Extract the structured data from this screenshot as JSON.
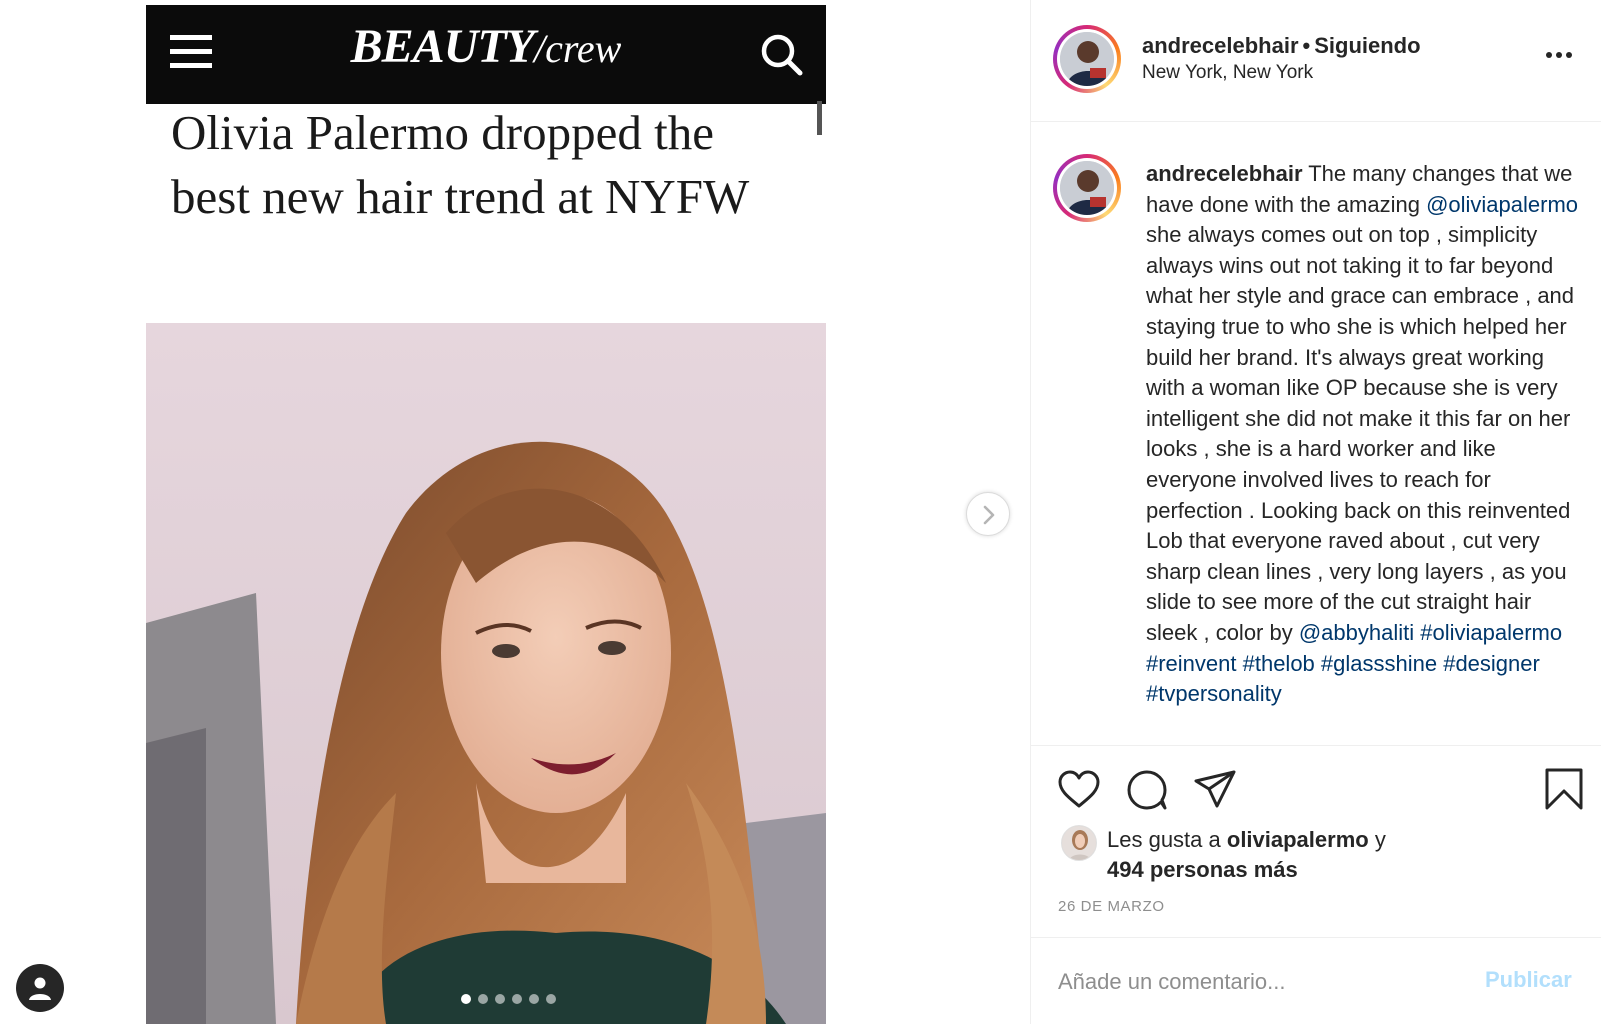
{
  "article": {
    "brand_main": "BEAUTY",
    "brand_slash": "/",
    "brand_sub": "crew",
    "headline": "Olivia Palermo dropped the best new hair trend at NYFW"
  },
  "carousel": {
    "total": 6,
    "active_index": 0
  },
  "header": {
    "username": "andrecelebhair",
    "separator": "•",
    "follow_status": "Siguiendo",
    "location": "New York, New York"
  },
  "caption": {
    "username": "andrecelebhair",
    "text_1": " The many changes that we have done with the amazing ",
    "mention_1": "@oliviapalermo",
    "text_2": " she always comes out on top , simplicity always wins out not taking it to far beyond what her style and grace can embrace , and staying true to who she is which helped her build her brand. It's always great working with a woman like OP because she is very intelligent she did not make it this far on her looks , she is a hard worker and like everyone involved lives to reach for perfection . Looking back on this reinvented Lob that everyone raved about , cut very sharp clean lines , very long layers , as you slide to see more of the cut straight hair sleek , color by ",
    "mention_2": "@abbyhaliti",
    "hashtags": "#oliviapalermo #reinvent #thelob #glassshine #designer #tvpersonality"
  },
  "likes": {
    "prefix": "Les gusta a ",
    "user": "oliviapalermo",
    "connector": " y",
    "others": "494 personas más"
  },
  "post_date": "26 DE MARZO",
  "comment": {
    "placeholder": "Añade un comentario...",
    "publish_label": "Publicar"
  },
  "colors": {
    "link": "#00376b",
    "publish_disabled": "#b2dffc",
    "muted": "#8e8e8e"
  },
  "icons": [
    "menu-icon",
    "search-icon",
    "chevron-right-icon",
    "more-icon",
    "heart-icon",
    "comment-icon",
    "send-icon",
    "bookmark-icon",
    "profile-icon"
  ]
}
